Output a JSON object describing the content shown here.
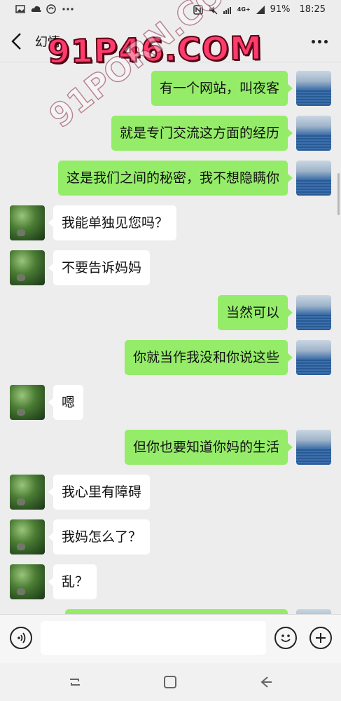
{
  "status_bar": {
    "left_icons": [
      "image-icon",
      "cloud-icon",
      "sync-icon",
      "more-dots-icon"
    ],
    "right_icons": [
      "nfc-icon",
      "mute-icon",
      "wifi-signal-icon",
      "4g-signal-icon",
      "signal-icon"
    ],
    "network_label": "4G+",
    "battery": "91%",
    "time": "18:25"
  },
  "header": {
    "title": "幻情",
    "back_icon": "chevron-left-icon",
    "more_icon": "more-horizontal-icon"
  },
  "watermark": {
    "primary": "91P46.COM",
    "secondary": "91PORN.COM"
  },
  "messages": [
    {
      "sender": "me",
      "text": "有一个网站，叫夜客"
    },
    {
      "sender": "me",
      "text": "就是专门交流这方面的经历"
    },
    {
      "sender": "me",
      "text": "这是我们之间的秘密，我不想隐瞒你"
    },
    {
      "sender": "other",
      "text": "我能单独见您吗？"
    },
    {
      "sender": "other",
      "text": "不要告诉妈妈"
    },
    {
      "sender": "me",
      "text": "当然可以"
    },
    {
      "sender": "me",
      "text": "你就当作我没和你说这些"
    },
    {
      "sender": "other",
      "text": "嗯"
    },
    {
      "sender": "me",
      "text": "但你也要知道你妈的生活"
    },
    {
      "sender": "other",
      "text": "我心里有障碍"
    },
    {
      "sender": "other",
      "text": "我妈怎么了？"
    },
    {
      "sender": "other",
      "text": "乱？"
    }
  ],
  "input_bar": {
    "voice_icon": "voice-icon",
    "emoji_icon": "emoji-icon",
    "plus_icon": "plus-icon",
    "value": ""
  },
  "nav_bar": {
    "icons": [
      "recents-icon",
      "home-icon",
      "back-icon"
    ]
  },
  "colors": {
    "background": "#ededed",
    "my_bubble": "#95ec69",
    "their_bubble": "#ffffff",
    "watermark": "#ff3b6b"
  }
}
